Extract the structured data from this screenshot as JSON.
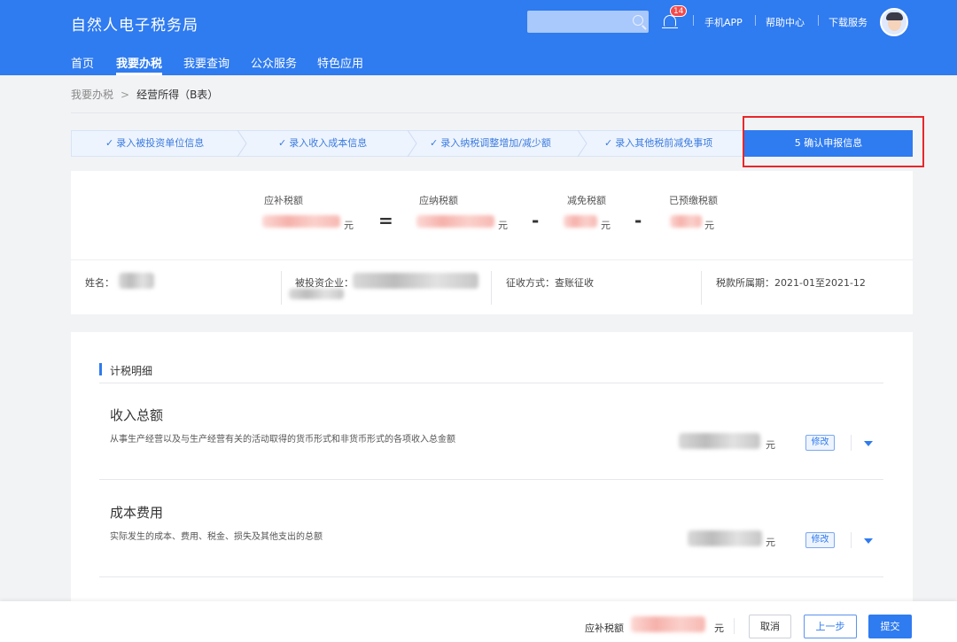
{
  "header": {
    "site_title": "自然人电子税务局",
    "notification_count": "14",
    "links": [
      "手机APP",
      "帮助中心",
      "下载服务"
    ],
    "brand_color": "#2f7bf0"
  },
  "nav": {
    "items": [
      "首页",
      "我要办税",
      "我要查询",
      "公众服务",
      "特色应用"
    ],
    "active": "我要办税"
  },
  "breadcrumb": {
    "home": "我要办税",
    "separator": ">",
    "current": "经营所得（B表）"
  },
  "steps": {
    "items": [
      "录入被投资单位信息",
      "录入收入成本信息",
      "录入纳税调整增加/减少额",
      "录入其他税前减免事项"
    ],
    "check_icon": "✓",
    "active_label": "5  确认申报信息"
  },
  "summary": {
    "labels": [
      "应补税额",
      "应纳税额",
      "减免税额",
      "已预缴税额"
    ],
    "unit": "元",
    "ops": [
      "=",
      "-",
      "-"
    ]
  },
  "info": {
    "name_label": "姓名：",
    "company_label": "被投资企业：",
    "method_label": "征收方式：",
    "method_value": "查账征收",
    "period_label": "税款所属期：",
    "period_value": "2021-01至2021-12"
  },
  "detail": {
    "section_title": "计税明细",
    "items": [
      {
        "title": "收入总额",
        "desc": "从事生产经营以及与生产经营有关的活动取得的货币形式和非货币形式的各项收入总金额",
        "unit": "元",
        "edit": "修改"
      },
      {
        "title": "成本费用",
        "desc": "实际发生的成本、费用、税金、损失及其他支出的总额",
        "unit": "元",
        "edit": "修改"
      }
    ]
  },
  "footer": {
    "label": "应补税额",
    "unit": "元",
    "cancel": "取消",
    "prev": "上一步",
    "submit": "提交"
  }
}
